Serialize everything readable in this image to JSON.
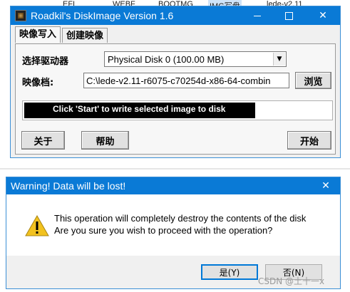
{
  "background": {
    "strip_items": [
      "EFI",
      "WEBF",
      "BOOTMG",
      "IMG写盘",
      "lede-v2.11"
    ]
  },
  "main_window": {
    "title": "Roadkil's DiskImage Version 1.6",
    "tabs": [
      {
        "label": "映像写入",
        "active": true
      },
      {
        "label": "创建映像",
        "active": false
      }
    ],
    "drive_label": "选择驱动器",
    "drive_value": "Physical Disk 0 (100.00 MB)",
    "image_label": "映像档:",
    "image_path": "C:\\lede-v2.11-r6075-c70254d-x86-64-combin",
    "browse_button": "浏览",
    "progress_message": "Click 'Start' to write selected image to disk",
    "about_button": "关于",
    "help_button": "帮助",
    "start_button": "开始",
    "colors": {
      "titlebar": "#0a7ad6",
      "progress": "#000000"
    }
  },
  "warning_dialog": {
    "title": "Warning! Data will be lost!",
    "line1": "This operation will completely destroy the contents of the disk",
    "line2": "Are you sure you wish to proceed with the operation?",
    "yes_button": "是(Y)",
    "no_button": "否(N)",
    "icon": "warning-triangle-icon"
  },
  "watermark": "CSDN @土十一x"
}
